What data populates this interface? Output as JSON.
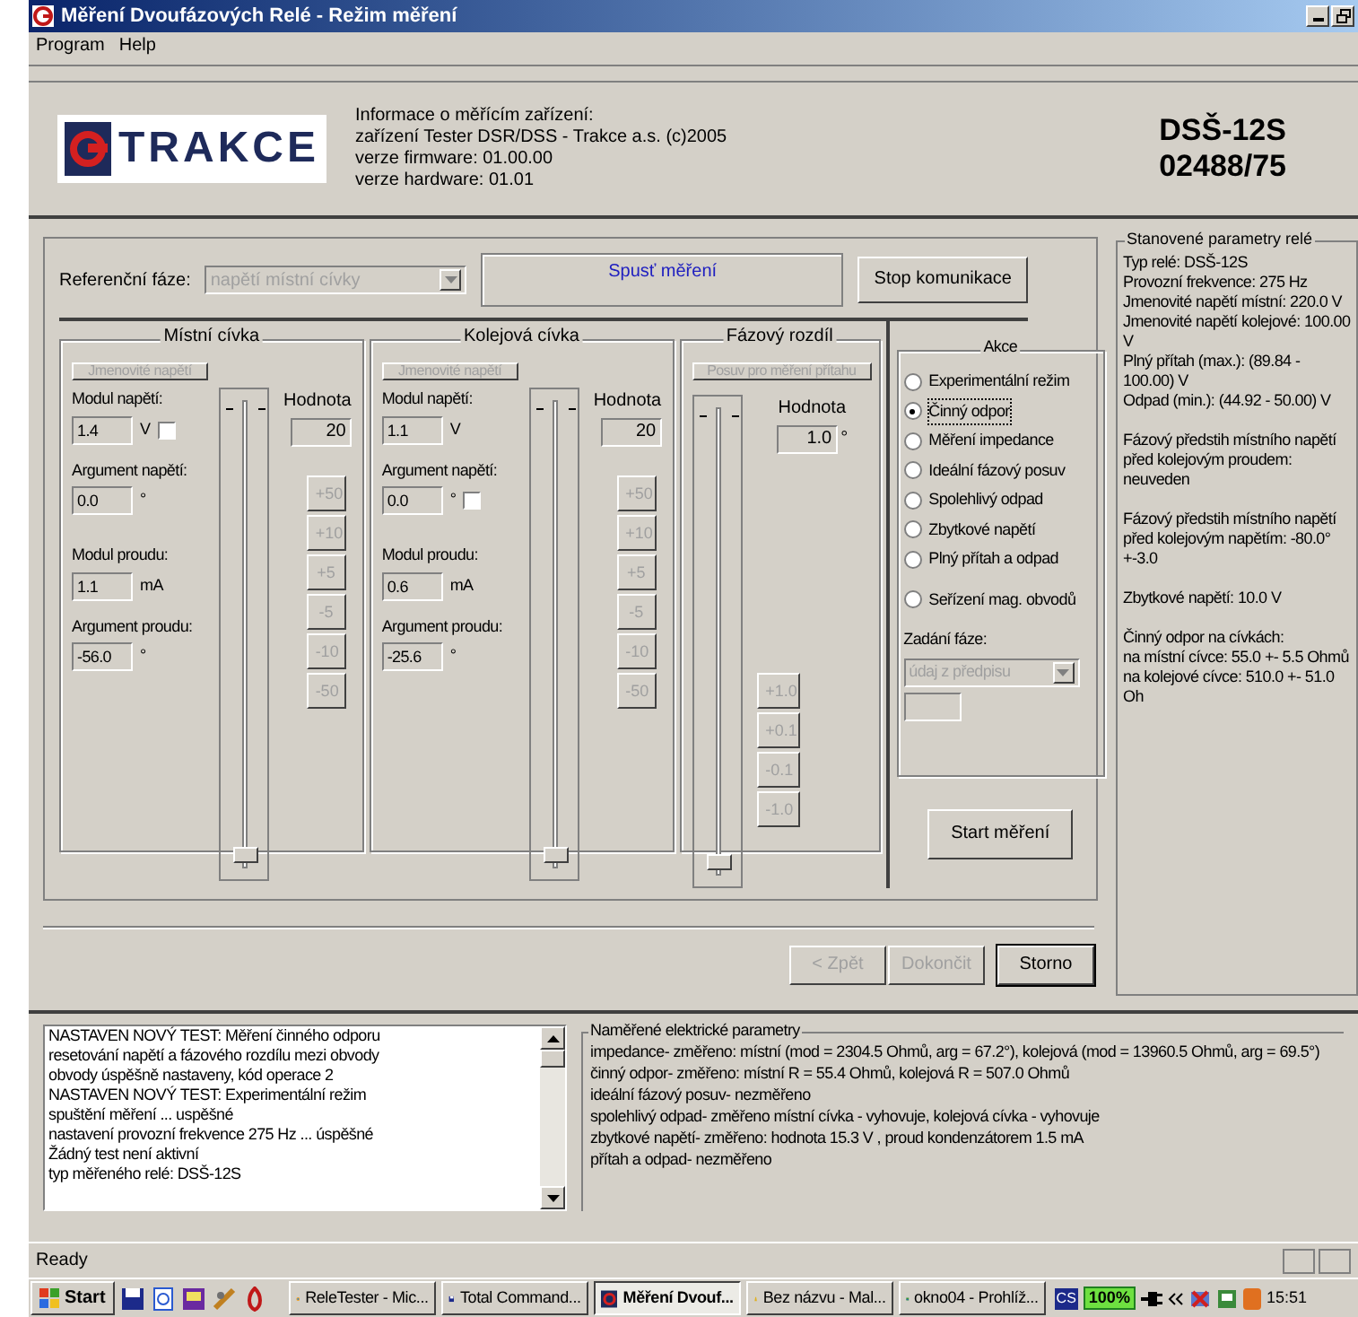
{
  "window": {
    "title": "Měření Dvoufázových Relé - Režim měření"
  },
  "menu": [
    "Program",
    "Help"
  ],
  "device_info": {
    "logo": "TRAKCE",
    "lines": [
      "Informace o měřícím zařízení:",
      "zařízení Tester DSR/DSS - Trakce a.s. (c)2005",
      "verze firmware: 01.00.00",
      "verze hardware: 01.01"
    ],
    "model": "DSŠ-12S",
    "serial": "02488/75"
  },
  "reference_phase": {
    "label": "Referenční fáze:",
    "value": "napětí místní cívky",
    "disabled": true
  },
  "prompt": "Spusť měření",
  "stop_button": "Stop komunikace",
  "coils": [
    {
      "title": "Místní cívka",
      "button": {
        "label": "Jmenovité napětí",
        "disabled": true
      },
      "fields": [
        {
          "label": "Modul napětí:",
          "value": "1.4",
          "unit": "V",
          "checkbox": {
            "checked": false
          }
        },
        {
          "label": "Argument napětí:",
          "value": "0.0",
          "unit": "°"
        },
        {
          "label": "Modul proudu:",
          "value": "1.1",
          "unit": "mA"
        },
        {
          "label": "Argument proudu:",
          "value": "-56.0",
          "unit": "°"
        }
      ],
      "value_label": "Hodnota",
      "value": "20",
      "level": 0.02,
      "steps": [
        {
          "label": "+50",
          "disabled": true
        },
        {
          "label": "+10",
          "disabled": true
        },
        {
          "label": "+5",
          "disabled": true
        },
        {
          "label": "-5",
          "disabled": true
        },
        {
          "label": "-10",
          "disabled": true
        },
        {
          "label": "-50",
          "disabled": true
        }
      ]
    },
    {
      "title": "Kolejová cívka",
      "button": {
        "label": "Jmenovité napětí",
        "disabled": true
      },
      "fields": [
        {
          "label": "Modul napětí:",
          "value": "1.1",
          "unit": "V"
        },
        {
          "label": "Argument napětí:",
          "value": "0.0",
          "unit": "°",
          "checkbox": {
            "checked": false
          }
        },
        {
          "label": "Modul proudu:",
          "value": "0.6",
          "unit": "mA"
        },
        {
          "label": "Argument proudu:",
          "value": "-25.6",
          "unit": "°"
        }
      ],
      "value_label": "Hodnota",
      "value": "20",
      "level": 0.02,
      "steps": [
        {
          "label": "+50",
          "disabled": true
        },
        {
          "label": "+10",
          "disabled": true
        },
        {
          "label": "+5",
          "disabled": true
        },
        {
          "label": "-5",
          "disabled": true
        },
        {
          "label": "-10",
          "disabled": true
        },
        {
          "label": "-50",
          "disabled": true
        }
      ]
    }
  ],
  "phase": {
    "title": "Fázový rozdíl",
    "button": {
      "label": "Posuv pro měření přítahu",
      "disabled": true
    },
    "value_label": "Hodnota",
    "value": "1.0",
    "unit": "°",
    "level": 0.02,
    "steps": [
      {
        "label": "+1.0",
        "disabled": true
      },
      {
        "label": "+0.1",
        "disabled": true
      },
      {
        "label": "-0.1",
        "disabled": true
      },
      {
        "label": "-1.0",
        "disabled": true
      }
    ]
  },
  "actions": {
    "title": "Akce",
    "options": [
      {
        "label": "Experimentální režim",
        "selected": false
      },
      {
        "label": "Činný odpor",
        "selected": true
      },
      {
        "label": "Měření impedance",
        "selected": false
      },
      {
        "label": "Ideální fázový posuv",
        "selected": false
      },
      {
        "label": "Spolehlivý odpad",
        "selected": false
      },
      {
        "label": "Zbytkové napětí",
        "selected": false
      },
      {
        "label": "Plný přítah a odpad",
        "selected": false
      },
      {
        "label": "Seřízení mag. obvodů",
        "selected": false
      }
    ],
    "phase_label": "Zadání fáze:",
    "phase_value": "údaj z předpisu",
    "phase_disabled": true,
    "start_button": "Start měření"
  },
  "nav_buttons": [
    {
      "label": "< Zpět",
      "disabled": true
    },
    {
      "label": "Dokončit",
      "disabled": true
    },
    {
      "label": "Storno",
      "disabled": false
    }
  ],
  "relay_params": {
    "title": "Stanovené parametry relé",
    "paragraphs": [
      [
        "Typ relé: DSŠ-12S",
        "Provozní frekvence: 275 Hz",
        "Jmenovité napětí místní: 220.0 V",
        "Jmenovité napětí kolejové: 100.00 V",
        "Plný přítah (max.): (89.84 - 100.00) V",
        "Odpad (min.): (44.92 - 50.00) V"
      ],
      [
        "Fázový předstih místního napětí",
        "před kolejovým proudem: neuveden"
      ],
      [
        "Fázový předstih místního napětí",
        "před kolejovým napětím: -80.0°+-3.0"
      ],
      [
        "Zbytkové napětí: 10.0 V"
      ],
      [
        "Činný odpor na cívkách:",
        "na místní cívce: 55.0 +- 5.5 Ohmů",
        "na kolejové cívce: 510.0 +- 51.0 Oh"
      ]
    ]
  },
  "log": [
    "NASTAVEN NOVÝ TEST: Měření činného odporu",
    "resetování napětí a fázového rozdílu mezi obvody",
    "obvody úspěšně nastaveny, kód operace 2",
    "NASTAVEN NOVÝ TEST: Experimentální režim",
    "spuštění měření ... uspěšné",
    "nastavení provozní frekvence 275 Hz ... úspěšné",
    "Žádný test není aktivní",
    "typ měřeného relé: DSŠ-12S"
  ],
  "measured": {
    "title": "Naměřené elektrické parametry",
    "lines": [
      "impedance- změřeno: místní (mod = 2304.5 Ohmů, arg = 67.2°), kolejová (mod = 13960.5 Ohmů, arg = 69.5°)",
      "činný odpor- změřeno: místní R = 55.4 Ohmů, kolejová R = 507.0 Ohmů",
      "ideální fázový posuv- nezměřeno",
      "spolehlivý odpad- změřeno místní cívka - vyhovuje, kolejová cívka - vyhovuje",
      "zbytkové napětí- změřeno: hodnota 15.3 V , proud kondenzátorem 1.5 mA",
      "přítah a odpad- nezměřeno"
    ]
  },
  "status_bar": "Ready",
  "taskbar": {
    "start": "Start",
    "tasks": [
      {
        "label": "ReleTester - Mic...",
        "selected": false
      },
      {
        "label": "Total Command...",
        "selected": false
      },
      {
        "label": "Měření Dvouf...",
        "selected": true
      },
      {
        "label": "Bez názvu - Mal...",
        "selected": false
      },
      {
        "label": "okno04 - Prohlíž...",
        "selected": false
      }
    ],
    "language": "CS",
    "battery": "100%",
    "clock": "15:51"
  }
}
